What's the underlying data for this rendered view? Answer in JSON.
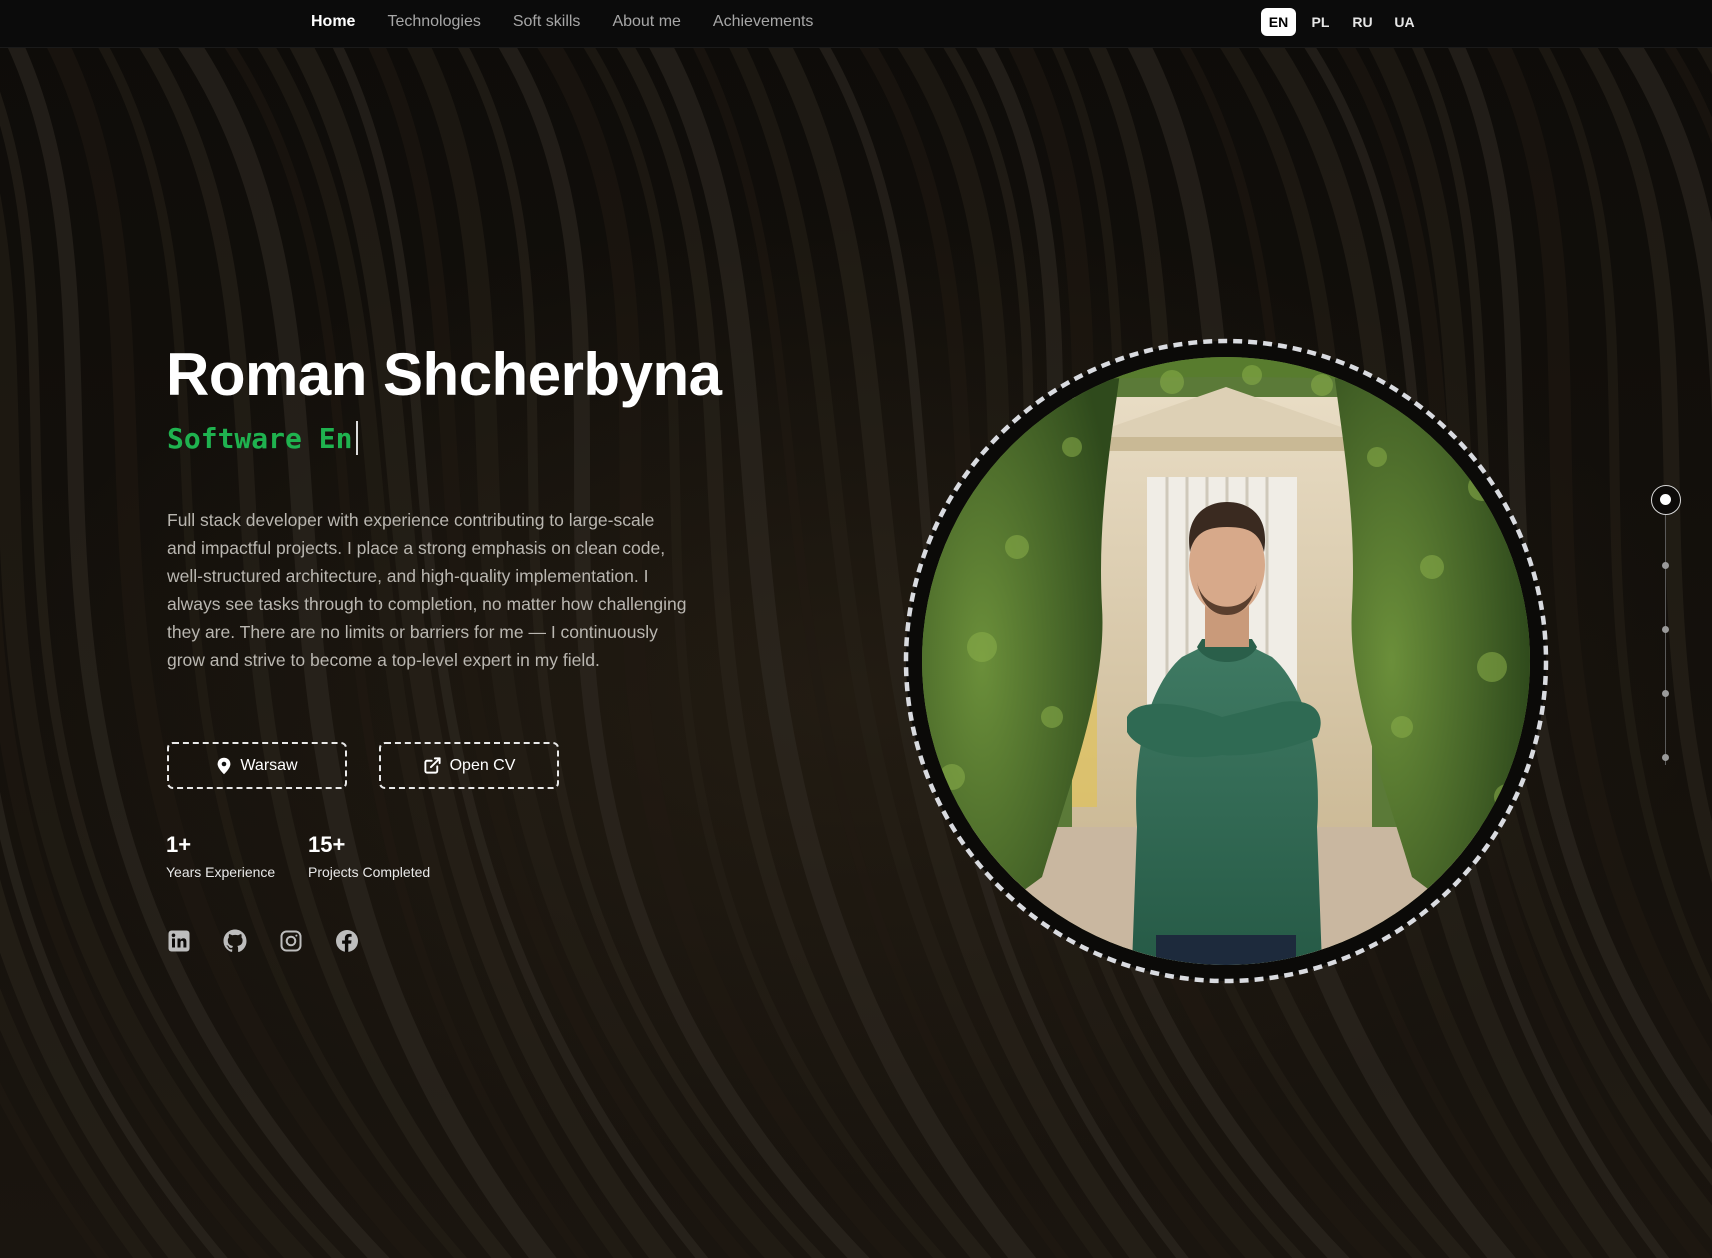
{
  "nav": {
    "items": [
      {
        "label": "Home",
        "active": true
      },
      {
        "label": "Technologies",
        "active": false
      },
      {
        "label": "Soft skills",
        "active": false
      },
      {
        "label": "About me",
        "active": false
      },
      {
        "label": "Achievements",
        "active": false
      }
    ],
    "languages": [
      {
        "label": "EN",
        "active": true
      },
      {
        "label": "PL",
        "active": false
      },
      {
        "label": "RU",
        "active": false
      },
      {
        "label": "UA",
        "active": false
      }
    ]
  },
  "hero": {
    "name": "Roman Shcherbyna",
    "typing_text": "Software En",
    "description": "Full stack developer with experience contributing to large-scale and impactful projects. I place a strong emphasis on clean code, well-structured architecture, and high-quality implementation. I always see tasks through to completion, no matter how challenging they are. There are no limits or barriers for me — I continuously grow and strive to become a top-level expert in my field.",
    "location_label": "Warsaw",
    "cv_label": "Open CV",
    "stats": [
      {
        "value": "1+",
        "label": "Years Experience"
      },
      {
        "value": "15+",
        "label": "Projects Completed"
      }
    ],
    "socials": [
      "linkedin-icon",
      "github-icon",
      "instagram-icon",
      "facebook-icon"
    ]
  },
  "side_nav": {
    "count": 5,
    "active_index": 0
  },
  "colors": {
    "accent_green": "#1fb24f",
    "background": "#0c0a08"
  }
}
